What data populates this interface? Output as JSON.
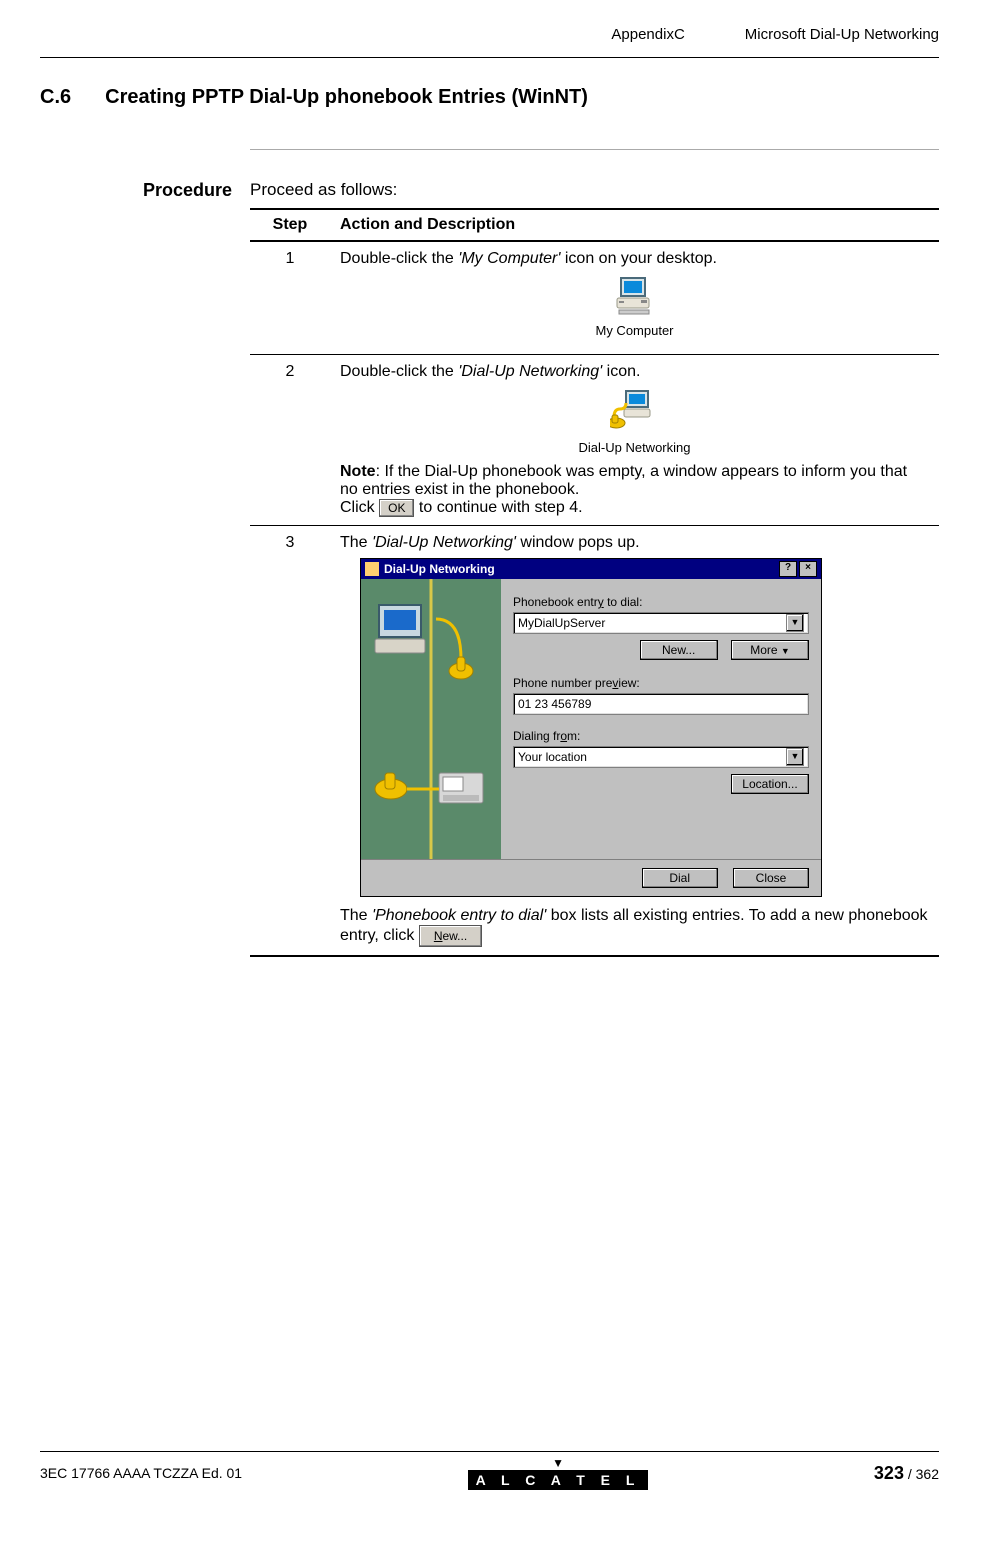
{
  "header": {
    "appendix": "AppendixC",
    "doc_title": "Microsoft Dial-Up Networking"
  },
  "section": {
    "number": "C.6",
    "title": "Creating PPTP Dial-Up phonebook Entries (WinNT)"
  },
  "procedure": {
    "label": "Procedure",
    "intro": "Proceed as follows:",
    "table": {
      "col_step": "Step",
      "col_action": "Action and Description"
    },
    "steps": {
      "s1": {
        "num": "1",
        "pre": "Double-click the ",
        "italic": "'My Computer'",
        "post": " icon on your desktop.",
        "icon_caption": "My Computer"
      },
      "s2": {
        "num": "2",
        "pre": "Double-click the ",
        "italic": "'Dial-Up Networking'",
        "post": " icon.",
        "icon_caption": "Dial-Up Networking",
        "note_label": "Note",
        "note_rest": ": If the Dial-Up phonebook was empty, a window appears to inform you that no entries exist in the phonebook.",
        "click_pre": "Click ",
        "ok_btn": "OK",
        "click_post": " to continue with step 4."
      },
      "s3": {
        "num": "3",
        "pre": "The ",
        "italic": "'Dial-Up Networking'",
        "post": " window pops up.",
        "after_pre": "The ",
        "after_italic": "'Phonebook entry to dial'",
        "after_mid": " box lists all existing entries. To add a new phonebook entry, click ",
        "after_btn_u": "N",
        "after_btn_rest": "ew..."
      }
    }
  },
  "dialog": {
    "title": "Dial-Up Networking",
    "help": "?",
    "close": "×",
    "lbl_entry_pre": "Phonebook entr",
    "lbl_entry_u": "y",
    "lbl_entry_post": " to dial:",
    "entry_val": "MyDialUpServer",
    "btn_new_u": "N",
    "btn_new_rest": "ew...",
    "btn_more_u": "M",
    "btn_more_rest": "ore ",
    "lbl_phone_pre": "Phone number pre",
    "lbl_phone_u": "v",
    "lbl_phone_post": "iew:",
    "phone_val": "01 23 456789",
    "lbl_from_pre": "Dialing fr",
    "lbl_from_u": "o",
    "lbl_from_post": "m:",
    "from_val": "Your location",
    "btn_loc_u": "L",
    "btn_loc_rest": "ocation...",
    "btn_dial_u": "D",
    "btn_dial_rest": "ial",
    "btn_close_u": "C",
    "btn_close_rest": "lose"
  },
  "footer": {
    "doc_id": "3EC 17766 AAAA TCZZA Ed. 01",
    "logo": "A L C A T E L",
    "page_cur": "323",
    "page_sep": " / ",
    "page_total": "362"
  }
}
